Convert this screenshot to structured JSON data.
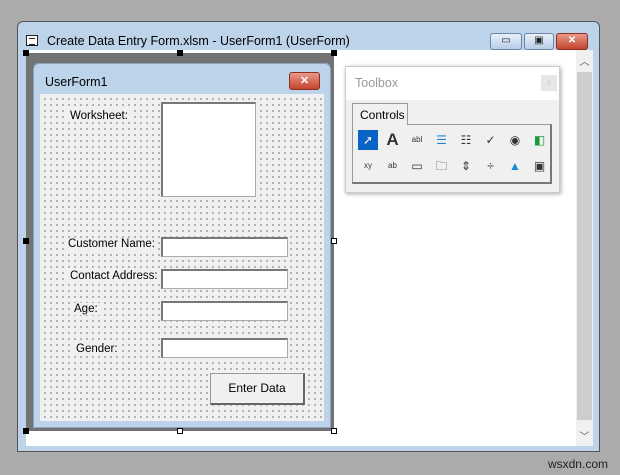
{
  "window": {
    "title": "Create Data Entry Form.xlsm - UserForm1 (UserForm)",
    "minimize": "▭",
    "restore": "▣",
    "close": "✕"
  },
  "form": {
    "title": "UserForm1",
    "close": "✕",
    "labels": {
      "worksheet": "Worksheet:",
      "customer_name": "Customer Name:",
      "contact_address": "Contact Address:",
      "age": "Age:",
      "gender": "Gender:"
    },
    "button": "Enter Data"
  },
  "toolbox": {
    "title": "Toolbox",
    "close": "x",
    "tab": "Controls",
    "icons": [
      {
        "name": "select-objects-icon",
        "glyph": "➚"
      },
      {
        "name": "label-icon",
        "glyph": "A"
      },
      {
        "name": "textbox-icon",
        "glyph": "abl"
      },
      {
        "name": "combobox-icon",
        "glyph": "☰"
      },
      {
        "name": "listbox-icon",
        "glyph": "☷"
      },
      {
        "name": "checkbox-icon",
        "glyph": "✓"
      },
      {
        "name": "option-button-icon",
        "glyph": "◉"
      },
      {
        "name": "toggle-button-icon",
        "glyph": "◧"
      },
      {
        "name": "frame-icon",
        "glyph": "xy"
      },
      {
        "name": "command-button-icon",
        "glyph": "ab"
      },
      {
        "name": "tabstrip-icon",
        "glyph": "▭"
      },
      {
        "name": "multipage-icon",
        "glyph": "🗀"
      },
      {
        "name": "scrollbar-icon",
        "glyph": "⇕"
      },
      {
        "name": "spinbutton-icon",
        "glyph": "÷"
      },
      {
        "name": "image-icon",
        "glyph": "▲"
      },
      {
        "name": "refedit-icon",
        "glyph": "▣"
      }
    ]
  },
  "watermark": "wsxdn.com"
}
